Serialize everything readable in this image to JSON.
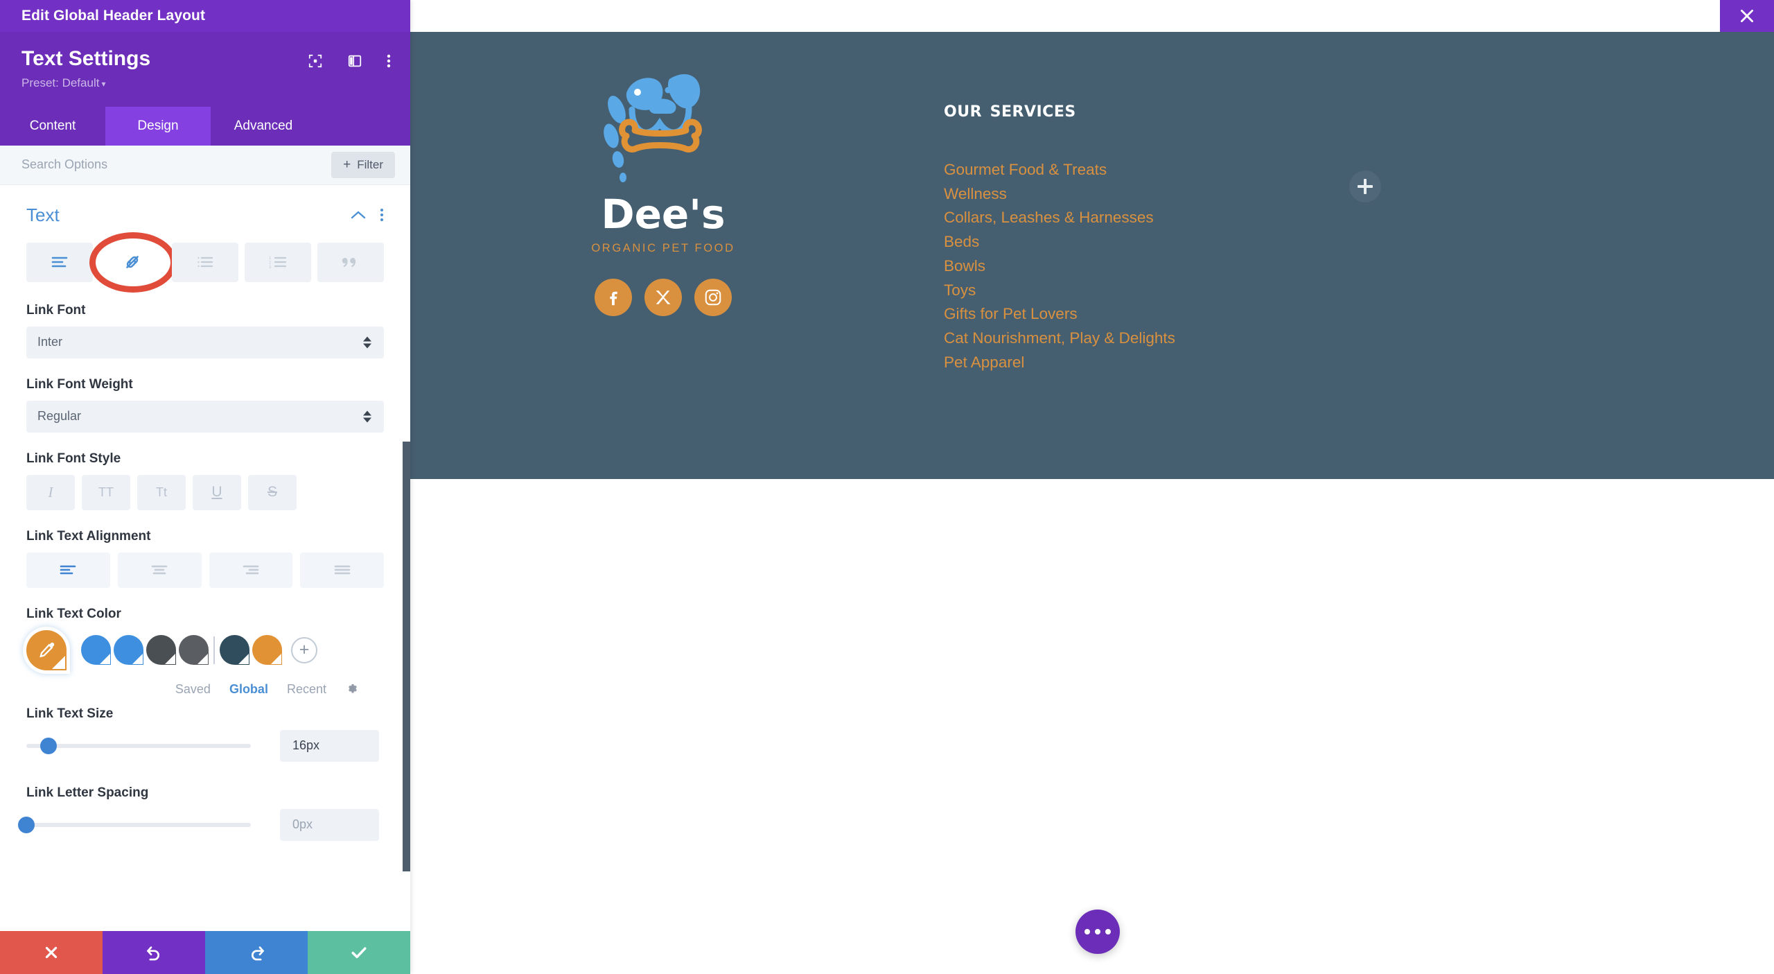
{
  "window": {
    "title": "Edit Global Header Layout",
    "close_icon": "close-icon"
  },
  "panel": {
    "title": "Text Settings",
    "preset_label": "Preset: Default",
    "header_icons": [
      "focus-target-icon",
      "split-view-icon",
      "kebab-menu-icon"
    ],
    "tabs": [
      {
        "label": "Content",
        "active": false
      },
      {
        "label": "Design",
        "active": true
      },
      {
        "label": "Advanced",
        "active": false
      }
    ],
    "search": {
      "placeholder": "Search Options",
      "value": ""
    },
    "filter_button": {
      "label": "Filter",
      "plus": "+"
    },
    "section": {
      "title": "Text",
      "collapse_icon": "chevron-up-icon",
      "menu_icon": "kebab-menu-icon",
      "type_tabs": [
        {
          "name": "paragraph-icon",
          "active": true,
          "highlighted": false
        },
        {
          "name": "link-icon",
          "active": false,
          "highlighted": true
        },
        {
          "name": "unordered-list-icon",
          "active": false,
          "highlighted": false
        },
        {
          "name": "ordered-list-icon",
          "active": false,
          "highlighted": false
        },
        {
          "name": "blockquote-icon",
          "active": false,
          "highlighted": false
        }
      ]
    },
    "fields": {
      "link_font": {
        "label": "Link Font",
        "value": "Inter"
      },
      "link_font_weight": {
        "label": "Link Font Weight",
        "value": "Regular"
      },
      "link_font_style": {
        "label": "Link Font Style",
        "options": [
          {
            "glyph": "I",
            "name": "italic-button"
          },
          {
            "glyph": "TT",
            "name": "uppercase-button"
          },
          {
            "glyph": "Tt",
            "name": "small-caps-button"
          },
          {
            "glyph": "U",
            "name": "underline-button"
          },
          {
            "glyph": "S",
            "name": "strikethrough-button"
          }
        ]
      },
      "link_text_alignment": {
        "label": "Link Text Alignment",
        "options": [
          {
            "name": "align-left-button",
            "active": true
          },
          {
            "name": "align-center-button",
            "active": false
          },
          {
            "name": "align-right-button",
            "active": false
          },
          {
            "name": "align-justify-button",
            "active": false
          }
        ]
      },
      "link_text_color": {
        "label": "Link Text Color",
        "picker_icon": "eyedropper-icon",
        "picker_color": "#e09235",
        "swatches": [
          {
            "color": "#3f8fe0"
          },
          {
            "color": "#3f8fe0"
          },
          {
            "color": "#4a4f53"
          },
          {
            "color": "#5a5e62"
          },
          {
            "color": "#2f4d5c"
          },
          {
            "color": "#e09235"
          }
        ],
        "add_icon": "plus-circle-icon",
        "tabs": [
          {
            "label": "Saved",
            "active": false
          },
          {
            "label": "Global",
            "active": true
          },
          {
            "label": "Recent",
            "active": false
          }
        ],
        "settings_icon": "gear-icon"
      },
      "link_text_size": {
        "label": "Link Text Size",
        "value": "16px",
        "slider_percent": 10
      },
      "link_letter_spacing": {
        "label": "Link Letter Spacing",
        "value": "0px",
        "is_placeholder": true,
        "slider_percent": 0
      }
    },
    "action_bar": [
      {
        "name": "cancel-button",
        "icon": "x-icon",
        "color": "#e2574c"
      },
      {
        "name": "undo-button",
        "icon": "undo-icon",
        "color": "#7231c4"
      },
      {
        "name": "redo-button",
        "icon": "redo-icon",
        "color": "#3f84d2"
      },
      {
        "name": "save-button",
        "icon": "check-icon",
        "color": "#5cc0a0"
      }
    ]
  },
  "canvas": {
    "footer_bg": "#455f71",
    "logo": {
      "wordmark": "Dee's",
      "tagline": "ORGANIC PET FOOD",
      "mark_colors": {
        "dog": "#5aa9e6",
        "bone": "#e09235"
      },
      "social": [
        {
          "name": "facebook-icon",
          "label": "f"
        },
        {
          "name": "x-twitter-icon",
          "label": "X"
        },
        {
          "name": "instagram-icon",
          "label": "IG"
        }
      ]
    },
    "services": {
      "title": "Our Services",
      "items": [
        "Gourmet Food & Treats",
        "Wellness",
        "Collars, Leashes & Harnesses",
        "Beds",
        "Bowls",
        "Toys",
        "Gifts for Pet Lovers",
        "Cat Nourishment, Play & Delights",
        "Pet Apparel"
      ],
      "link_color": "#d9913f"
    },
    "add_module_icon": "plus-icon",
    "fab": {
      "name": "page-settings-fab",
      "icon": "ellipsis-icon",
      "color": "#6c2eb9"
    }
  }
}
